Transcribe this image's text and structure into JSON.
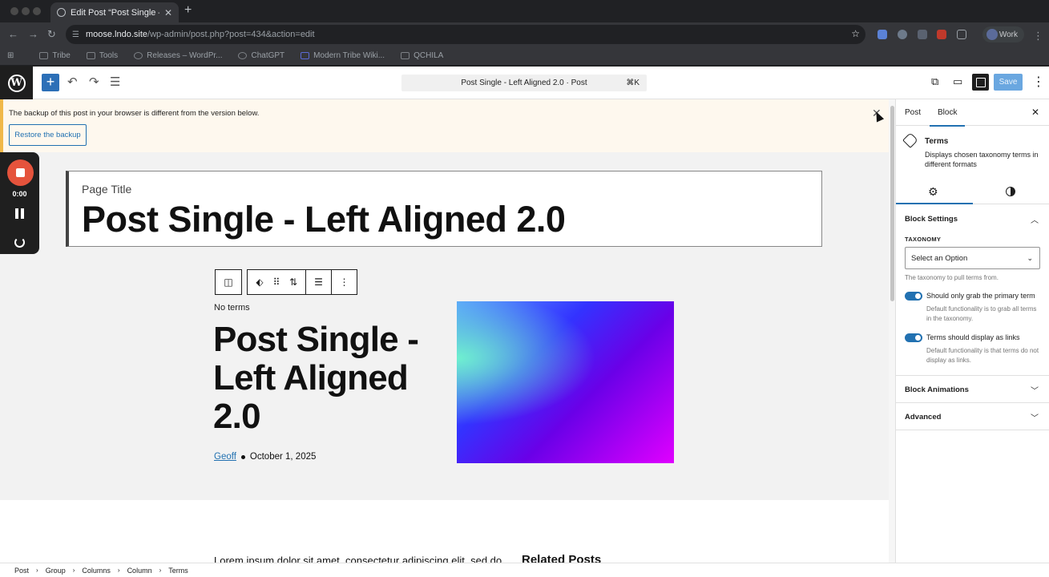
{
  "browser": {
    "tab_title": "Edit Post “Post Single – Left A",
    "url_host": "moose.lndo.site",
    "url_path": "/wp-admin/post.php?post=434&action=edit",
    "profile_label": "Work",
    "bookmarks": [
      "Tribe",
      "Tools",
      "Releases – WordPr...",
      "ChatGPT",
      "Modern Tribe Wiki...",
      "QCHILA"
    ]
  },
  "editor": {
    "command_bar": "Post Single - Left Aligned 2.0 · Post",
    "command_shortcut": "⌘K",
    "save_label": "Save"
  },
  "notice": {
    "message": "The backup of this post in your browser is different from the version below.",
    "restore_label": "Restore the backup"
  },
  "recorder": {
    "time": "0:00"
  },
  "canvas": {
    "page_title_label": "Page Title",
    "page_title": "Post Single - Left Aligned 2.0",
    "no_terms": "No terms",
    "post_heading": "Post Single - Left Aligned 2.0",
    "author": "Geoff",
    "date": "October 1, 2025",
    "lorem": "Lorem ipsum dolor sit amet, consectetur adipiscing elit, sed do",
    "related_heading": "Related Posts"
  },
  "sidebar": {
    "tabs": [
      "Post",
      "Block"
    ],
    "block_name": "Terms",
    "block_desc": "Displays chosen taxonomy terms in different formats",
    "block_settings": "Block Settings",
    "taxonomy_label": "TAXONOMY",
    "taxonomy_value": "Select an Option",
    "taxonomy_help": "The taxonomy to pull terms from.",
    "toggle1_label": "Should only grab the primary term",
    "toggle1_help": "Default functionality is to grab all terms in the taxonomy.",
    "toggle2_label": "Terms should display as links",
    "toggle2_help": "Default functionality is that terms do not display as links.",
    "block_animations": "Block Animations",
    "advanced": "Advanced"
  },
  "breadcrumb": [
    "Post",
    "Group",
    "Columns",
    "Column",
    "Terms"
  ],
  "colors": {
    "wp_blue": "#2271b1",
    "notice_bg": "#fef8ee",
    "recorder_red": "#e5533c"
  }
}
